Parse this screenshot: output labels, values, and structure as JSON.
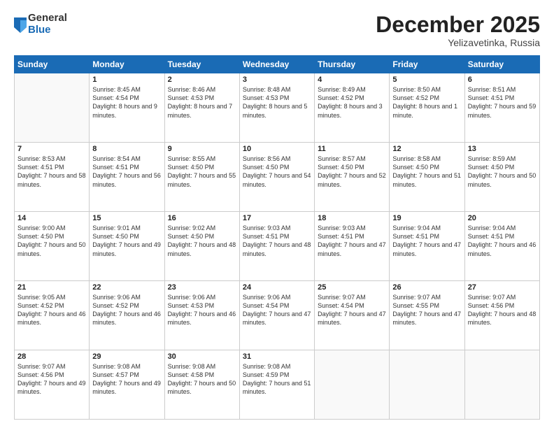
{
  "logo": {
    "general": "General",
    "blue": "Blue"
  },
  "header": {
    "month": "December 2025",
    "location": "Yelizavetinka, Russia"
  },
  "days_of_week": [
    "Sunday",
    "Monday",
    "Tuesday",
    "Wednesday",
    "Thursday",
    "Friday",
    "Saturday"
  ],
  "weeks": [
    [
      {
        "day": "",
        "sunrise": "",
        "sunset": "",
        "daylight": ""
      },
      {
        "day": "1",
        "sunrise": "Sunrise: 8:45 AM",
        "sunset": "Sunset: 4:54 PM",
        "daylight": "Daylight: 8 hours and 9 minutes."
      },
      {
        "day": "2",
        "sunrise": "Sunrise: 8:46 AM",
        "sunset": "Sunset: 4:53 PM",
        "daylight": "Daylight: 8 hours and 7 minutes."
      },
      {
        "day": "3",
        "sunrise": "Sunrise: 8:48 AM",
        "sunset": "Sunset: 4:53 PM",
        "daylight": "Daylight: 8 hours and 5 minutes."
      },
      {
        "day": "4",
        "sunrise": "Sunrise: 8:49 AM",
        "sunset": "Sunset: 4:52 PM",
        "daylight": "Daylight: 8 hours and 3 minutes."
      },
      {
        "day": "5",
        "sunrise": "Sunrise: 8:50 AM",
        "sunset": "Sunset: 4:52 PM",
        "daylight": "Daylight: 8 hours and 1 minute."
      },
      {
        "day": "6",
        "sunrise": "Sunrise: 8:51 AM",
        "sunset": "Sunset: 4:51 PM",
        "daylight": "Daylight: 7 hours and 59 minutes."
      }
    ],
    [
      {
        "day": "7",
        "sunrise": "Sunrise: 8:53 AM",
        "sunset": "Sunset: 4:51 PM",
        "daylight": "Daylight: 7 hours and 58 minutes."
      },
      {
        "day": "8",
        "sunrise": "Sunrise: 8:54 AM",
        "sunset": "Sunset: 4:51 PM",
        "daylight": "Daylight: 7 hours and 56 minutes."
      },
      {
        "day": "9",
        "sunrise": "Sunrise: 8:55 AM",
        "sunset": "Sunset: 4:50 PM",
        "daylight": "Daylight: 7 hours and 55 minutes."
      },
      {
        "day": "10",
        "sunrise": "Sunrise: 8:56 AM",
        "sunset": "Sunset: 4:50 PM",
        "daylight": "Daylight: 7 hours and 54 minutes."
      },
      {
        "day": "11",
        "sunrise": "Sunrise: 8:57 AM",
        "sunset": "Sunset: 4:50 PM",
        "daylight": "Daylight: 7 hours and 52 minutes."
      },
      {
        "day": "12",
        "sunrise": "Sunrise: 8:58 AM",
        "sunset": "Sunset: 4:50 PM",
        "daylight": "Daylight: 7 hours and 51 minutes."
      },
      {
        "day": "13",
        "sunrise": "Sunrise: 8:59 AM",
        "sunset": "Sunset: 4:50 PM",
        "daylight": "Daylight: 7 hours and 50 minutes."
      }
    ],
    [
      {
        "day": "14",
        "sunrise": "Sunrise: 9:00 AM",
        "sunset": "Sunset: 4:50 PM",
        "daylight": "Daylight: 7 hours and 50 minutes."
      },
      {
        "day": "15",
        "sunrise": "Sunrise: 9:01 AM",
        "sunset": "Sunset: 4:50 PM",
        "daylight": "Daylight: 7 hours and 49 minutes."
      },
      {
        "day": "16",
        "sunrise": "Sunrise: 9:02 AM",
        "sunset": "Sunset: 4:50 PM",
        "daylight": "Daylight: 7 hours and 48 minutes."
      },
      {
        "day": "17",
        "sunrise": "Sunrise: 9:03 AM",
        "sunset": "Sunset: 4:51 PM",
        "daylight": "Daylight: 7 hours and 48 minutes."
      },
      {
        "day": "18",
        "sunrise": "Sunrise: 9:03 AM",
        "sunset": "Sunset: 4:51 PM",
        "daylight": "Daylight: 7 hours and 47 minutes."
      },
      {
        "day": "19",
        "sunrise": "Sunrise: 9:04 AM",
        "sunset": "Sunset: 4:51 PM",
        "daylight": "Daylight: 7 hours and 47 minutes."
      },
      {
        "day": "20",
        "sunrise": "Sunrise: 9:04 AM",
        "sunset": "Sunset: 4:51 PM",
        "daylight": "Daylight: 7 hours and 46 minutes."
      }
    ],
    [
      {
        "day": "21",
        "sunrise": "Sunrise: 9:05 AM",
        "sunset": "Sunset: 4:52 PM",
        "daylight": "Daylight: 7 hours and 46 minutes."
      },
      {
        "day": "22",
        "sunrise": "Sunrise: 9:06 AM",
        "sunset": "Sunset: 4:52 PM",
        "daylight": "Daylight: 7 hours and 46 minutes."
      },
      {
        "day": "23",
        "sunrise": "Sunrise: 9:06 AM",
        "sunset": "Sunset: 4:53 PM",
        "daylight": "Daylight: 7 hours and 46 minutes."
      },
      {
        "day": "24",
        "sunrise": "Sunrise: 9:06 AM",
        "sunset": "Sunset: 4:54 PM",
        "daylight": "Daylight: 7 hours and 47 minutes."
      },
      {
        "day": "25",
        "sunrise": "Sunrise: 9:07 AM",
        "sunset": "Sunset: 4:54 PM",
        "daylight": "Daylight: 7 hours and 47 minutes."
      },
      {
        "day": "26",
        "sunrise": "Sunrise: 9:07 AM",
        "sunset": "Sunset: 4:55 PM",
        "daylight": "Daylight: 7 hours and 47 minutes."
      },
      {
        "day": "27",
        "sunrise": "Sunrise: 9:07 AM",
        "sunset": "Sunset: 4:56 PM",
        "daylight": "Daylight: 7 hours and 48 minutes."
      }
    ],
    [
      {
        "day": "28",
        "sunrise": "Sunrise: 9:07 AM",
        "sunset": "Sunset: 4:56 PM",
        "daylight": "Daylight: 7 hours and 49 minutes."
      },
      {
        "day": "29",
        "sunrise": "Sunrise: 9:08 AM",
        "sunset": "Sunset: 4:57 PM",
        "daylight": "Daylight: 7 hours and 49 minutes."
      },
      {
        "day": "30",
        "sunrise": "Sunrise: 9:08 AM",
        "sunset": "Sunset: 4:58 PM",
        "daylight": "Daylight: 7 hours and 50 minutes."
      },
      {
        "day": "31",
        "sunrise": "Sunrise: 9:08 AM",
        "sunset": "Sunset: 4:59 PM",
        "daylight": "Daylight: 7 hours and 51 minutes."
      },
      {
        "day": "",
        "sunrise": "",
        "sunset": "",
        "daylight": ""
      },
      {
        "day": "",
        "sunrise": "",
        "sunset": "",
        "daylight": ""
      },
      {
        "day": "",
        "sunrise": "",
        "sunset": "",
        "daylight": ""
      }
    ]
  ]
}
